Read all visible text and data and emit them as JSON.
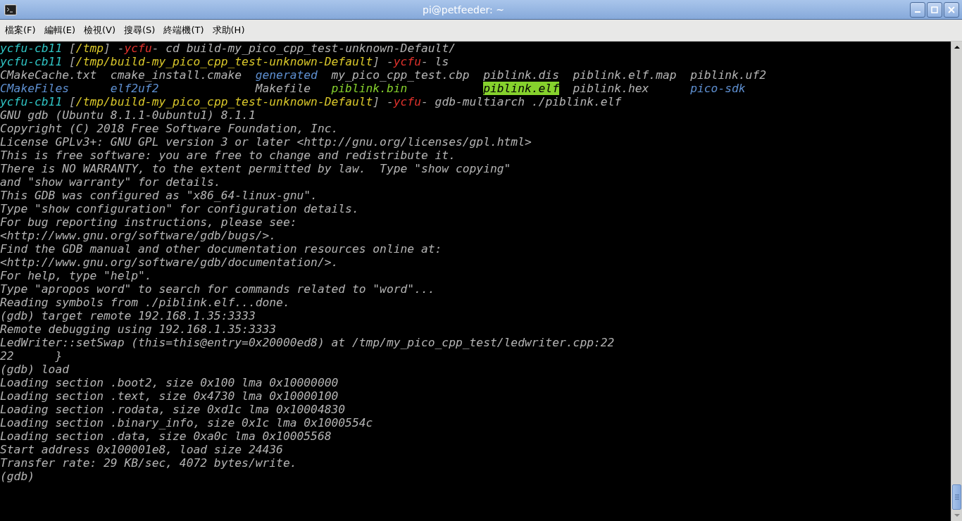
{
  "window": {
    "title": "pi@petfeeder: ~"
  },
  "menu": [
    "檔案(F)",
    "編輯(E)",
    "檢視(V)",
    "搜尋(S)",
    "終端機(T)",
    "求助(H)"
  ],
  "terminal": {
    "lines": [
      {
        "kind": "text",
        "segments": [
          {
            "kind": "host",
            "text": "ycfu-cb11"
          },
          {
            "kind": "plain",
            "text": " ["
          },
          {
            "kind": "path",
            "text": "/tmp"
          },
          {
            "kind": "plain",
            "text": "] -"
          },
          {
            "kind": "user",
            "text": "ycfu"
          },
          {
            "kind": "plain",
            "text": "- "
          },
          {
            "kind": "command",
            "text": "cd build-my_pico_cpp_test-unknown-Default/"
          }
        ]
      },
      {
        "kind": "text",
        "segments": [
          {
            "kind": "host",
            "text": "ycfu-cb11"
          },
          {
            "kind": "plain",
            "text": " ["
          },
          {
            "kind": "path",
            "text": "/tmp/build-my_pico_cpp_test-unknown-Default"
          },
          {
            "kind": "plain",
            "text": "] -"
          },
          {
            "kind": "user",
            "text": "ycfu"
          },
          {
            "kind": "plain",
            "text": "- "
          },
          {
            "kind": "command",
            "text": "ls"
          }
        ]
      },
      {
        "kind": "ls",
        "cells": [
          {
            "kind": "file",
            "text": "CMakeCache.txt"
          },
          {
            "kind": "file",
            "text": "cmake_install.cmake"
          },
          {
            "kind": "dir",
            "text": "generated"
          },
          {
            "kind": "file",
            "text": "my_pico_cpp_test.cbp"
          },
          {
            "kind": "file",
            "text": "piblink.dis"
          },
          {
            "kind": "file",
            "text": "piblink.elf.map"
          },
          {
            "kind": "file",
            "text": "piblink.uf2"
          }
        ]
      },
      {
        "kind": "ls",
        "cells": [
          {
            "kind": "dir",
            "text": "CMakeFiles"
          },
          {
            "kind": "dir",
            "text": "elf2uf2"
          },
          {
            "kind": "file",
            "text": "Makefile"
          },
          {
            "kind": "exec",
            "text": "piblink.bin"
          },
          {
            "kind": "highlight",
            "text": "piblink.elf"
          },
          {
            "kind": "file",
            "text": "piblink.hex"
          },
          {
            "kind": "dir",
            "text": "pico-sdk"
          }
        ]
      },
      {
        "kind": "text",
        "segments": [
          {
            "kind": "host",
            "text": "ycfu-cb11"
          },
          {
            "kind": "plain",
            "text": " ["
          },
          {
            "kind": "path",
            "text": "/tmp/build-my_pico_cpp_test-unknown-Default"
          },
          {
            "kind": "plain",
            "text": "] -"
          },
          {
            "kind": "user",
            "text": "ycfu"
          },
          {
            "kind": "plain",
            "text": "- "
          },
          {
            "kind": "command",
            "text": "gdb-multiarch ./piblink.elf"
          }
        ]
      },
      {
        "kind": "text",
        "segments": [
          {
            "kind": "output",
            "text": "GNU gdb (Ubuntu 8.1.1-0ubuntu1) 8.1.1"
          }
        ]
      },
      {
        "kind": "text",
        "segments": [
          {
            "kind": "output",
            "text": "Copyright (C) 2018 Free Software Foundation, Inc."
          }
        ]
      },
      {
        "kind": "text",
        "segments": [
          {
            "kind": "output",
            "text": "License GPLv3+: GNU GPL version 3 or later <http://gnu.org/licenses/gpl.html>"
          }
        ]
      },
      {
        "kind": "text",
        "segments": [
          {
            "kind": "output",
            "text": "This is free software: you are free to change and redistribute it."
          }
        ]
      },
      {
        "kind": "text",
        "segments": [
          {
            "kind": "output",
            "text": "There is NO WARRANTY, to the extent permitted by law.  Type \"show copying\""
          }
        ]
      },
      {
        "kind": "text",
        "segments": [
          {
            "kind": "output",
            "text": "and \"show warranty\" for details."
          }
        ]
      },
      {
        "kind": "text",
        "segments": [
          {
            "kind": "output",
            "text": "This GDB was configured as \"x86_64-linux-gnu\"."
          }
        ]
      },
      {
        "kind": "text",
        "segments": [
          {
            "kind": "output",
            "text": "Type \"show configuration\" for configuration details."
          }
        ]
      },
      {
        "kind": "text",
        "segments": [
          {
            "kind": "output",
            "text": "For bug reporting instructions, please see:"
          }
        ]
      },
      {
        "kind": "text",
        "segments": [
          {
            "kind": "output",
            "text": "<http://www.gnu.org/software/gdb/bugs/>."
          }
        ]
      },
      {
        "kind": "text",
        "segments": [
          {
            "kind": "output",
            "text": "Find the GDB manual and other documentation resources online at:"
          }
        ]
      },
      {
        "kind": "text",
        "segments": [
          {
            "kind": "output",
            "text": "<http://www.gnu.org/software/gdb/documentation/>."
          }
        ]
      },
      {
        "kind": "text",
        "segments": [
          {
            "kind": "output",
            "text": "For help, type \"help\"."
          }
        ]
      },
      {
        "kind": "text",
        "segments": [
          {
            "kind": "output",
            "text": "Type \"apropos word\" to search for commands related to \"word\"..."
          }
        ]
      },
      {
        "kind": "text",
        "segments": [
          {
            "kind": "output",
            "text": "Reading symbols from ./piblink.elf...done."
          }
        ]
      },
      {
        "kind": "text",
        "segments": [
          {
            "kind": "output",
            "text": "(gdb) target remote 192.168.1.35:3333"
          }
        ]
      },
      {
        "kind": "text",
        "segments": [
          {
            "kind": "output",
            "text": "Remote debugging using 192.168.1.35:3333"
          }
        ]
      },
      {
        "kind": "text",
        "segments": [
          {
            "kind": "output",
            "text": "LedWriter::setSwap (this=this@entry=0x20000ed8) at /tmp/my_pico_cpp_test/ledwriter.cpp:22"
          }
        ]
      },
      {
        "kind": "text",
        "segments": [
          {
            "kind": "output",
            "text": "22      }"
          }
        ]
      },
      {
        "kind": "text",
        "segments": [
          {
            "kind": "output",
            "text": "(gdb) load"
          }
        ]
      },
      {
        "kind": "text",
        "segments": [
          {
            "kind": "output",
            "text": "Loading section .boot2, size 0x100 lma 0x10000000"
          }
        ]
      },
      {
        "kind": "text",
        "segments": [
          {
            "kind": "output",
            "text": "Loading section .text, size 0x4730 lma 0x10000100"
          }
        ]
      },
      {
        "kind": "text",
        "segments": [
          {
            "kind": "output",
            "text": "Loading section .rodata, size 0xd1c lma 0x10004830"
          }
        ]
      },
      {
        "kind": "text",
        "segments": [
          {
            "kind": "output",
            "text": "Loading section .binary_info, size 0x1c lma 0x1000554c"
          }
        ]
      },
      {
        "kind": "text",
        "segments": [
          {
            "kind": "output",
            "text": "Loading section .data, size 0xa0c lma 0x10005568"
          }
        ]
      },
      {
        "kind": "text",
        "segments": [
          {
            "kind": "output",
            "text": "Start address 0x100001e8, load size 24436"
          }
        ]
      },
      {
        "kind": "text",
        "segments": [
          {
            "kind": "output",
            "text": "Transfer rate: 29 KB/sec, 4072 bytes/write."
          }
        ]
      },
      {
        "kind": "text",
        "segments": [
          {
            "kind": "output",
            "text": "(gdb)"
          }
        ]
      }
    ]
  }
}
